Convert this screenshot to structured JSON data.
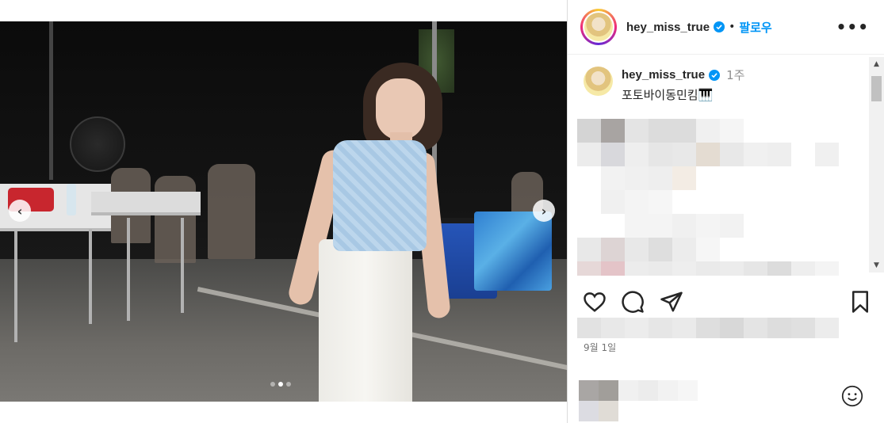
{
  "post": {
    "username": "hey_miss_true",
    "separator": "•",
    "follow_label": "팔로우",
    "more_label": "•••"
  },
  "caption": {
    "username": "hey_miss_true",
    "time": "1주",
    "text": "포토바이동민킴🎹"
  },
  "carousel": {
    "prev_label": "‹",
    "next_label": "›",
    "slide_count": 3,
    "active_slide": 2
  },
  "actions": {
    "like_icon": "heart-icon",
    "comment_icon": "comment-icon",
    "share_icon": "send-icon",
    "save_icon": "bookmark-icon"
  },
  "date": "9월 1일",
  "scrollbar": {
    "up": "▲",
    "down": "▼"
  },
  "colors": {
    "accent": "#0095f6",
    "verified": "#0095f6",
    "text": "#262626",
    "muted": "#8e8e8e"
  }
}
